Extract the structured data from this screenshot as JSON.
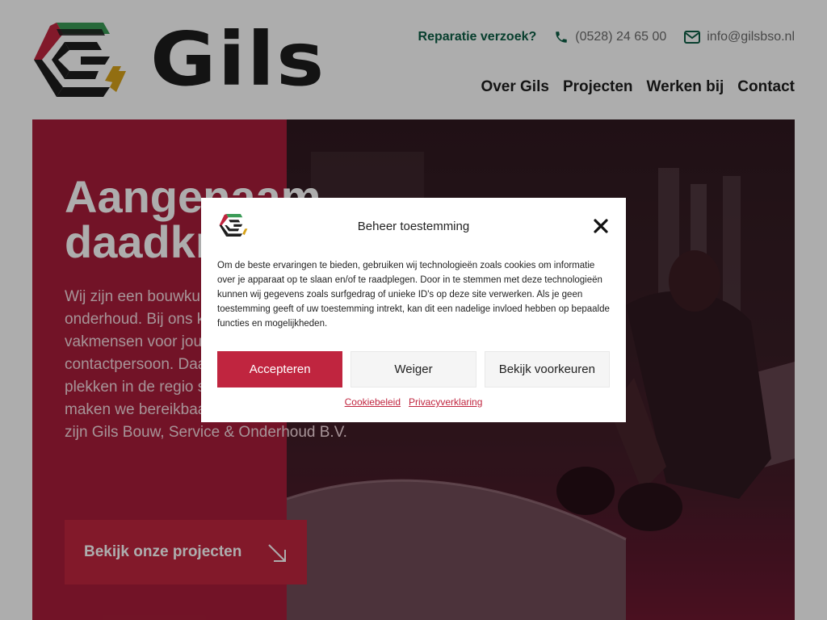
{
  "brand": {
    "name": "Gils",
    "logo_colors": [
      "#3a9b56",
      "#c0253f",
      "#d8a31a",
      "#1d1d1d"
    ]
  },
  "header": {
    "repair_link": "Reparatie verzoek?",
    "phone": "(0528) 24 65 00",
    "email": "info@gilsbso.nl",
    "nav": [
      "Over Gils",
      "Projecten",
      "Werken bij",
      "Contact"
    ]
  },
  "hero": {
    "title_line1": "Aangenaam",
    "title_line2": "daadkrachtig",
    "body": "Wij zijn een bouwkundig bedrijf gespecialiseerd in onderhoud. Bij ons krijg je enthousiaste vakmensen voor jouw klus, maar ook een vast contactpersoon. Daarnaast is Gils op de meeste plekken in de regio snel aanrijden bij je deur. En maken we bereikbaarheid ook écht bereikbaar. Wij zijn Gils Bouw, Service & Onderhoud B.V.",
    "cta_label": "Bekijk onze projecten"
  },
  "consent": {
    "title": "Beheer toestemming",
    "text": "Om de beste ervaringen te bieden, gebruiken wij technologieën zoals cookies om informatie over je apparaat op te slaan en/of te raadplegen. Door in te stemmen met deze technologieën kunnen wij gegevens zoals surfgedrag of unieke ID's op deze site verwerken. Als je geen toestemming geeft of uw toestemming intrekt, kan dit een nadelige invloed hebben op bepaalde functies en mogelijkheden.",
    "buttons": {
      "accept": "Accepteren",
      "deny": "Weiger",
      "preferences": "Bekijk voorkeuren"
    },
    "links": {
      "cookie_policy": "Cookiebeleid",
      "privacy": "Privacyverklaring"
    }
  },
  "colors": {
    "accent": "#c0253f",
    "repair_link": "#0d5e45",
    "hero_red": "#a81d3a"
  }
}
